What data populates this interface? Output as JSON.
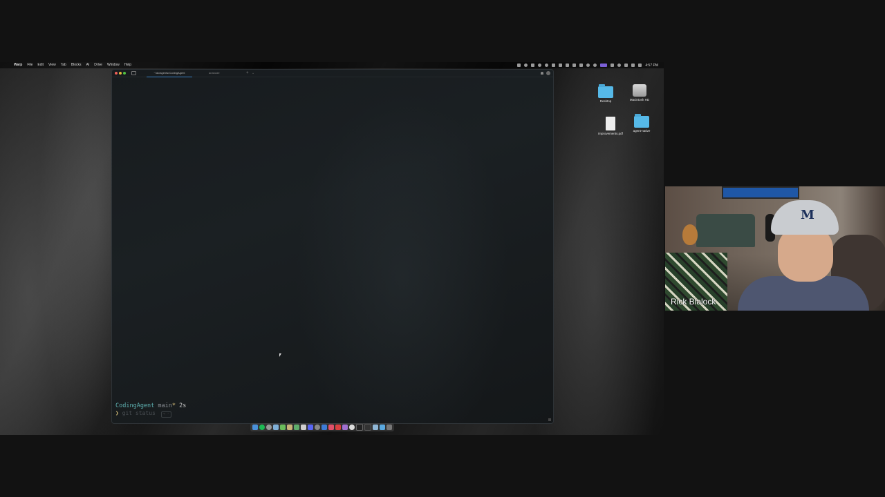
{
  "menubar": {
    "apple_icon": "apple-icon",
    "app_name": "Warp",
    "items": [
      "File",
      "Edit",
      "View",
      "Tab",
      "Blocks",
      "AI",
      "Drive",
      "Window",
      "Help"
    ],
    "clock": "4:57 PM"
  },
  "warp": {
    "tabs": [
      {
        "label": "~/dc/agents/CodingAgent",
        "active": true
      },
      {
        "label": "ananode",
        "active": false
      }
    ],
    "prompt": {
      "directory": "CodingAgent",
      "branch": "main",
      "dirty_marker": "*",
      "duration": "2s",
      "caret": "❯",
      "input_placeholder": "git status",
      "hint": "→ ·"
    }
  },
  "desktop_icons": [
    {
      "label": "Desktop",
      "kind": "folder"
    },
    {
      "label": "Macintosh HD",
      "kind": "disk"
    },
    {
      "label": "improvements.pdf",
      "kind": "document"
    },
    {
      "label": "agent-native",
      "kind": "folder"
    }
  ],
  "dock": {
    "apps": [
      "finder",
      "spotify",
      "chrome",
      "safari",
      "messages",
      "notes",
      "maps",
      "photos",
      "discord",
      "calendar",
      "mail",
      "music",
      "slack",
      "figma",
      "terminal",
      "vscode",
      "xcode",
      "preview",
      "trash"
    ]
  },
  "webcam": {
    "participant_name": "Rick Blalock",
    "cap_logo": "M"
  },
  "colors": {
    "accent_tab": "#3b82c4",
    "prompt_dir": "#5fb3b3",
    "prompt_dirty": "#d9c27a",
    "folder": "#56b9e8"
  }
}
